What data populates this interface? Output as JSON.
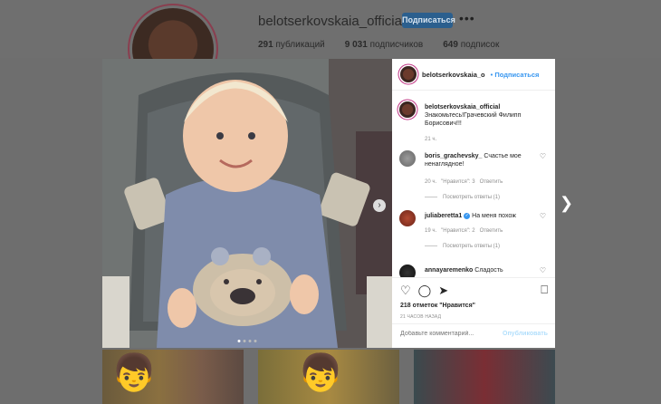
{
  "profile": {
    "username": "belotserkovskaia_official",
    "follow_label": "Подписаться",
    "more_label": "•••",
    "stats": [
      {
        "num": "291",
        "label": "публикаций"
      },
      {
        "num": "9 031",
        "label": "подписчиков"
      },
      {
        "num": "649",
        "label": "подписок"
      }
    ]
  },
  "post": {
    "header_username": "belotserkovskaia_o",
    "header_follow": "Подписаться",
    "caption": {
      "username": "belotserkovskaia_official",
      "text": "Знакомьтесь!Грачевский Филипп Борисович!!!",
      "time": "21 ч."
    },
    "comments": [
      {
        "username": "boris_grachevsky_",
        "text": "Счастье мое ненаглядное!",
        "time": "20 ч.",
        "likes": "\"Нравится\": 3",
        "reply": "Ответить",
        "replies": "Посмотреть ответы (1)",
        "verified": false
      },
      {
        "username": "juliaberetta1",
        "text": "На меня похож",
        "time": "19 ч.",
        "likes": "\"Нравится\": 2",
        "reply": "Ответить",
        "replies": "Посмотреть ответы (1)",
        "verified": true
      },
      {
        "username": "annayaremenko",
        "text": "Сладость",
        "verified": false
      }
    ],
    "likes": "218 отметок \"Нравится\"",
    "time_ago": "21 ЧАСОВ НАЗАД",
    "comment_placeholder": "Добавьте комментарий...",
    "publish_label": "Опубликовать"
  },
  "icons": {
    "like": "heart-icon",
    "comment": "comment-icon",
    "share": "share-icon",
    "save": "bookmark-icon",
    "next": "chevron-right-icon"
  }
}
